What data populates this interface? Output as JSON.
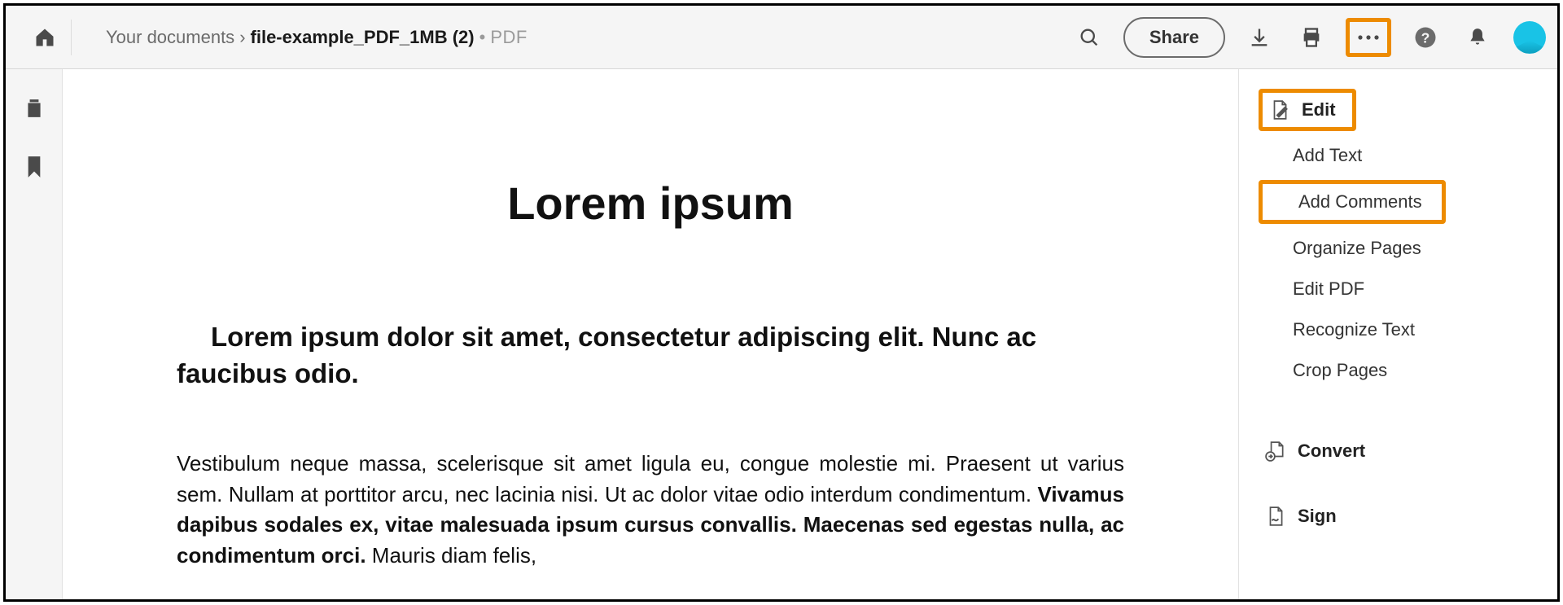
{
  "header": {
    "breadcrumb_location": "Your documents",
    "filename": "file-example_PDF_1MB (2)",
    "filetype": "PDF",
    "share_label": "Share"
  },
  "document": {
    "title": "Lorem ipsum",
    "subheading": "Lorem ipsum dolor sit amet, consectetur adipiscing elit. Nunc ac faucibus odio.",
    "para_part1": "Vestibulum neque massa, scelerisque sit amet ligula eu, congue molestie mi. Praesent ut varius sem. Nullam at porttitor arcu, nec lacinia nisi. Ut ac dolor vitae odio interdum condimentum. ",
    "para_bold": "Vivamus dapibus sodales ex, vitae malesuada ipsum cursus convallis. Maecenas sed egestas nulla, ac condimentum orci.",
    "para_part2": " Mauris diam felis,"
  },
  "right_panel": {
    "edit_label": "Edit",
    "add_text": "Add Text",
    "add_comments": "Add Comments",
    "organize_pages": "Organize Pages",
    "edit_pdf": "Edit PDF",
    "recognize_text": "Recognize Text",
    "crop_pages": "Crop Pages",
    "convert_label": "Convert",
    "sign_label": "Sign"
  }
}
